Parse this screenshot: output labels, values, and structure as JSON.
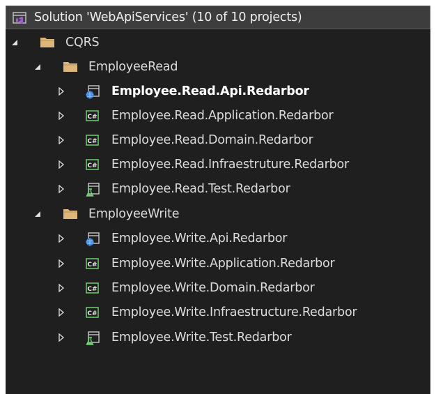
{
  "solution": {
    "title": "Solution 'WebApiServices' (10 of 10 projects)"
  },
  "tree": {
    "cqrs": {
      "label": "CQRS"
    },
    "employee_read": {
      "label": "EmployeeRead",
      "projects": [
        {
          "label": "Employee.Read.Api.Redarbor",
          "icon": "web-project-icon"
        },
        {
          "label": "Employee.Read.Application.Redarbor",
          "icon": "csharp-project-icon"
        },
        {
          "label": "Employee.Read.Domain.Redarbor",
          "icon": "csharp-project-icon"
        },
        {
          "label": "Employee.Read.Infraestruture.Redarbor",
          "icon": "csharp-project-icon"
        },
        {
          "label": "Employee.Read.Test.Redarbor",
          "icon": "test-project-icon"
        }
      ]
    },
    "employee_write": {
      "label": "EmployeeWrite",
      "projects": [
        {
          "label": "Employee.Write.Api.Redarbor",
          "icon": "web-project-icon"
        },
        {
          "label": "Employee.Write.Application.Redarbor",
          "icon": "csharp-project-icon"
        },
        {
          "label": "Employee.Write.Domain.Redarbor",
          "icon": "csharp-project-icon"
        },
        {
          "label": "Employee.Write.Infraestructure.Redarbor",
          "icon": "csharp-project-icon"
        },
        {
          "label": "Employee.Write.Test.Redarbor",
          "icon": "test-project-icon"
        }
      ]
    }
  },
  "colors": {
    "background": "#1f1f1f",
    "header": "#3d3d3d",
    "folder": "#dcb67a",
    "csharp": "#6fd16f",
    "web": "#2e7bd6",
    "text": "#dcdcdc"
  }
}
